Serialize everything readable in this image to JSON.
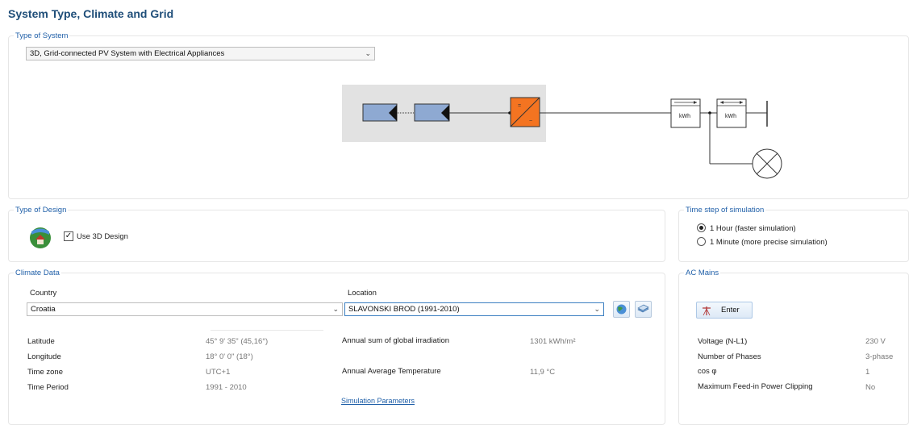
{
  "page": {
    "title": "System Type, Climate and Grid"
  },
  "system_type": {
    "legend": "Type of System",
    "selected": "3D, Grid-connected PV System with Electrical Appliances",
    "diagram": {
      "meter_label_1": "kWh",
      "meter_label_2": "kWh",
      "inverter_dc": "=",
      "inverter_ac": "~"
    }
  },
  "design": {
    "legend": "Type of Design",
    "use_3d_label": "Use 3D Design",
    "use_3d_checked": true
  },
  "time_step": {
    "legend": "Time step of simulation",
    "options": [
      {
        "label": "1 Hour (faster simulation)",
        "selected": true
      },
      {
        "label": "1 Minute (more precise simulation)",
        "selected": false
      }
    ]
  },
  "climate": {
    "legend": "Climate Data",
    "country_label": "Country",
    "country_value": "Croatia",
    "location_label": "Location",
    "location_value": "SLAVONSKI BROD (1991-2010)",
    "rows": [
      {
        "label": "Latitude",
        "value": "45° 9' 35\"  (45,16°)"
      },
      {
        "label": "Longitude",
        "value": "18° 0' 0\"  (18°)"
      },
      {
        "label": "Time zone",
        "value": "UTC+1"
      },
      {
        "label": "Time Period",
        "value": "1991 - 2010"
      }
    ],
    "irradiation_label": "Annual sum of global irradiation",
    "irradiation_value": "1301 kWh/m²",
    "temperature_label": "Annual Average Temperature",
    "temperature_value": "11,9 °C",
    "sim_params_link": "Simulation Parameters"
  },
  "ac_mains": {
    "legend": "AC Mains",
    "enter_label": "Enter",
    "rows": [
      {
        "label": "Voltage (N-L1)",
        "value": "230 V"
      },
      {
        "label": "Number of Phases",
        "value": "3-phase"
      },
      {
        "label": "cos φ",
        "value": "1"
      },
      {
        "label": "Maximum Feed-in Power Clipping",
        "value": "No"
      }
    ]
  },
  "colors": {
    "accent": "#1f5fa8",
    "title": "#1f4e79",
    "pv_module": "#8ea9d2",
    "inverter": "#f47421",
    "diagram_bg": "#e2e2e2"
  }
}
